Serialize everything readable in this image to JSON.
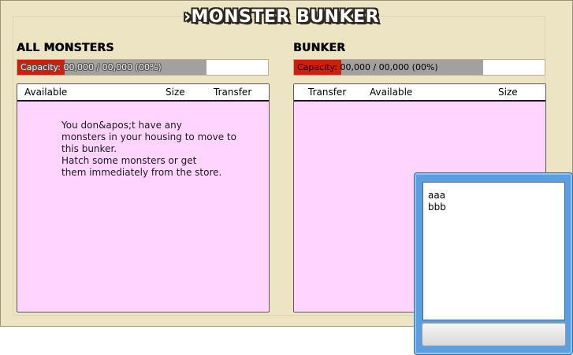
{
  "title": "›MONSTER BUNKER",
  "left": {
    "heading": "ALL MONSTERS",
    "capacity_label": "Capacity:",
    "capacity_value": "00,000 / 00,000 (00%)",
    "columns": {
      "available": "Available",
      "size": "Size",
      "transfer": "Transfer"
    },
    "empty_message_lines": [
      "You don&apos;t have any",
      "monsters in your housing to move to",
      "this bunker.",
      "Hatch some monsters or get",
      "them immediately from the store."
    ]
  },
  "right": {
    "heading": "BUNKER",
    "capacity_label": "Capacity:",
    "capacity_value": "00,000 / 00,000 (00%)",
    "columns": {
      "transfer": "Transfer",
      "available": "Available",
      "size": "Size"
    }
  },
  "popup": {
    "items": [
      "aaa",
      "bbb"
    ],
    "button_label": ""
  },
  "colors": {
    "background": "#ece4c3",
    "panel": "#ffd4ff",
    "capacity_red": "#d11d09",
    "capacity_grey": "#a3a1a0",
    "popup_blue": "#5b9fe0"
  }
}
